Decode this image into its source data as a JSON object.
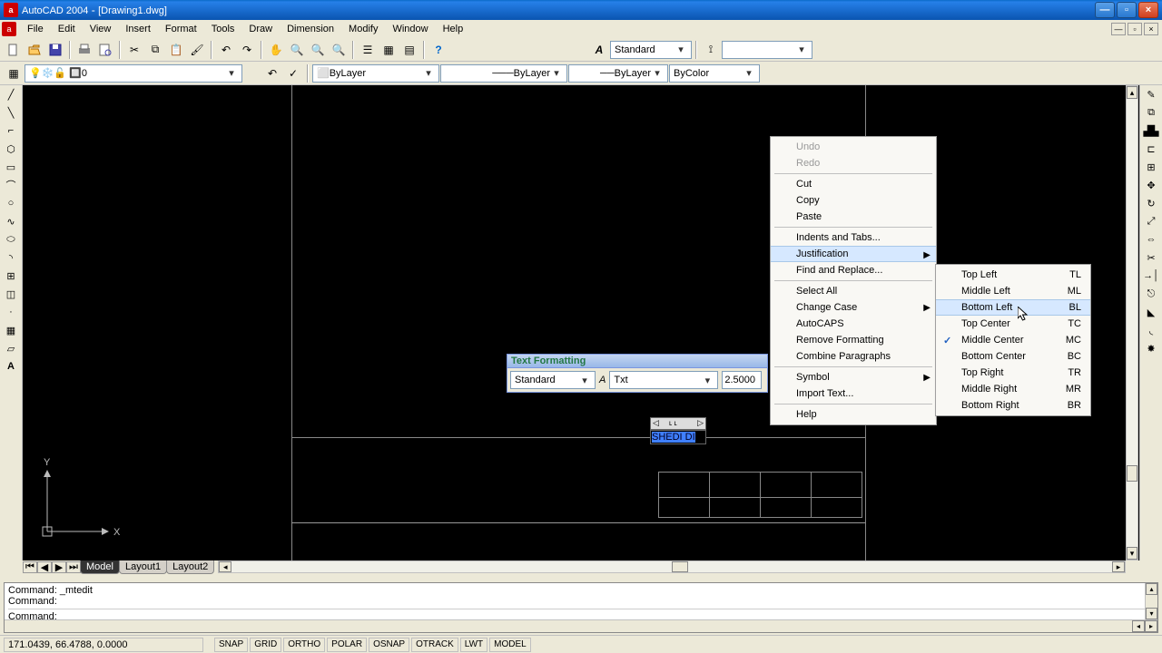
{
  "titlebar": {
    "app": "AutoCAD 2004",
    "doc": "[Drawing1.dwg]"
  },
  "menubar": {
    "items": [
      "File",
      "Edit",
      "View",
      "Insert",
      "Format",
      "Tools",
      "Draw",
      "Dimension",
      "Modify",
      "Window",
      "Help"
    ]
  },
  "toolbar1": {
    "style_combo": "Standard",
    "layer_combo": "0",
    "linetype": "ByLayer",
    "lineweight": "ByLayer",
    "color": "ByColor"
  },
  "txtfmt": {
    "title": "Text Formatting",
    "style": "Standard",
    "font": "Txt",
    "size": "2.5000"
  },
  "mtext": {
    "text": "SHEDI  DI"
  },
  "tabs": {
    "items": [
      "Model",
      "Layout1",
      "Layout2"
    ],
    "active": 0
  },
  "cmdline": {
    "l1": "Command: _mtedit",
    "l2": "Command:",
    "l3": "Command:"
  },
  "statusbar": {
    "coords": "171.0439, 66.4788, 0.0000",
    "buttons": [
      "SNAP",
      "GRID",
      "ORTHO",
      "POLAR",
      "OSNAP",
      "OTRACK",
      "LWT",
      "MODEL"
    ]
  },
  "ctx1": [
    {
      "t": "Undo",
      "d": true
    },
    {
      "t": "Redo",
      "d": true
    },
    {
      "sep": true
    },
    {
      "t": "Cut"
    },
    {
      "t": "Copy"
    },
    {
      "t": "Paste"
    },
    {
      "sep": true
    },
    {
      "t": "Indents and Tabs..."
    },
    {
      "t": "Justification",
      "sub": true,
      "hl": true
    },
    {
      "t": "Find and Replace..."
    },
    {
      "sep": true
    },
    {
      "t": "Select All"
    },
    {
      "t": "Change Case",
      "sub": true
    },
    {
      "t": "AutoCAPS"
    },
    {
      "t": "Remove Formatting"
    },
    {
      "t": "Combine Paragraphs"
    },
    {
      "sep": true
    },
    {
      "t": "Symbol",
      "sub": true
    },
    {
      "t": "Import Text..."
    },
    {
      "sep": true
    },
    {
      "t": "Help"
    }
  ],
  "ctx2": [
    {
      "t": "Top Left",
      "s": "TL"
    },
    {
      "t": "Middle Left",
      "s": "ML"
    },
    {
      "t": "Bottom Left",
      "s": "BL",
      "hl": true
    },
    {
      "t": "Top Center",
      "s": "TC"
    },
    {
      "t": "Middle Center",
      "s": "MC",
      "chk": true
    },
    {
      "t": "Bottom Center",
      "s": "BC"
    },
    {
      "t": "Top Right",
      "s": "TR"
    },
    {
      "t": "Middle Right",
      "s": "MR"
    },
    {
      "t": "Bottom Right",
      "s": "BR"
    }
  ],
  "ucs": {
    "x": "X",
    "y": "Y"
  }
}
